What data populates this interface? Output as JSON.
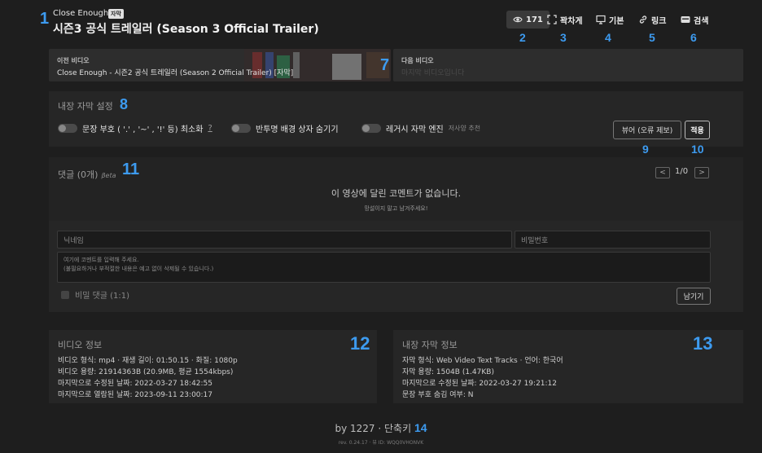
{
  "header": {
    "show_name": "Close Enough",
    "sub_tag": "자막",
    "video_title": "시즌3 공식 트레일러 (Season 3 Official Trailer)"
  },
  "toolbar": {
    "views": "171",
    "fullscreen_label": "꽉차게",
    "default_label": "기본",
    "link_label": "링크",
    "search_label": "검색"
  },
  "nav": {
    "prev_label": "이전 비디오",
    "prev_value": "Close Enough - 시즌2 공식 트레일러 (Season 2 Official Trailer) [자막]",
    "next_label": "다음 비디오",
    "next_value": "마지막 비디오입니다"
  },
  "settings": {
    "title": "내장 자막 설정",
    "toggle1_label": "문장 부호 ( '.' , '~' , '!' 등) 최소화",
    "toggle1_help": "?",
    "toggle2_label": "반투명 배경 상자 숨기기",
    "toggle3_label": "레거시 자막 엔진",
    "toggle3_note": "저사양 추천",
    "viewer_button": "뷰어 (오류 제보)",
    "apply_button": "적용"
  },
  "comments": {
    "title": "댓글 (0개)",
    "beta": "βeta",
    "page_prev": "<",
    "page_info": "1/0",
    "page_next": ">",
    "empty_message": "이 영상에 달린 코멘트가 없습니다.",
    "empty_sub": "망설이지 말고 남겨주세요!",
    "nick_placeholder": "닉네임",
    "password_placeholder": "비밀번호",
    "body_line1": "여기에 코멘트를 입력해 주세요.",
    "body_line2": "(불필요하거나 부적절한 내용은 예고 없이 삭제될 수 있습니다.)",
    "secret_label": "비밀 댓글 (1:1)",
    "submit_button": "남기기"
  },
  "video_info": {
    "title": "비디오 정보",
    "rows": [
      "비디오 형식: mp4 · 재생 길이: 01:50.15 · 화질: 1080p",
      "비디오 용량: 21914363B (20.9MB, 평균 1554kbps)",
      "마지막으로 수정된 날짜: 2022-03-27 18:42:55",
      "마지막으로 열람된 날짜: 2023-09-11 23:00:17"
    ]
  },
  "subtitle_info": {
    "title": "내장 자막 정보",
    "rows": [
      "자막 형식: Web Video Text Tracks · 언어: 한국어",
      "자막 용량: 1504B (1.47KB)",
      "마지막으로 수정된 날짜: 2022-03-27 19:21:12",
      "문장 부호 숨김 여부: N"
    ]
  },
  "footer": {
    "by": "by 1227 · 단축키",
    "rev": "rev. 0.24.17 · 뷰 ID: WQQ0VHONVK"
  },
  "annotations": {
    "n1": "1",
    "n2": "2",
    "n3": "3",
    "n4": "4",
    "n5": "5",
    "n6": "6",
    "n7": "7",
    "n8": "8",
    "n9": "9",
    "n10": "10",
    "n11": "11",
    "n12": "12",
    "n13": "13",
    "n14": "14"
  },
  "colors": {
    "annotation": "#3d9bf0",
    "background": "#1e1e1e",
    "panel": "#262626"
  }
}
